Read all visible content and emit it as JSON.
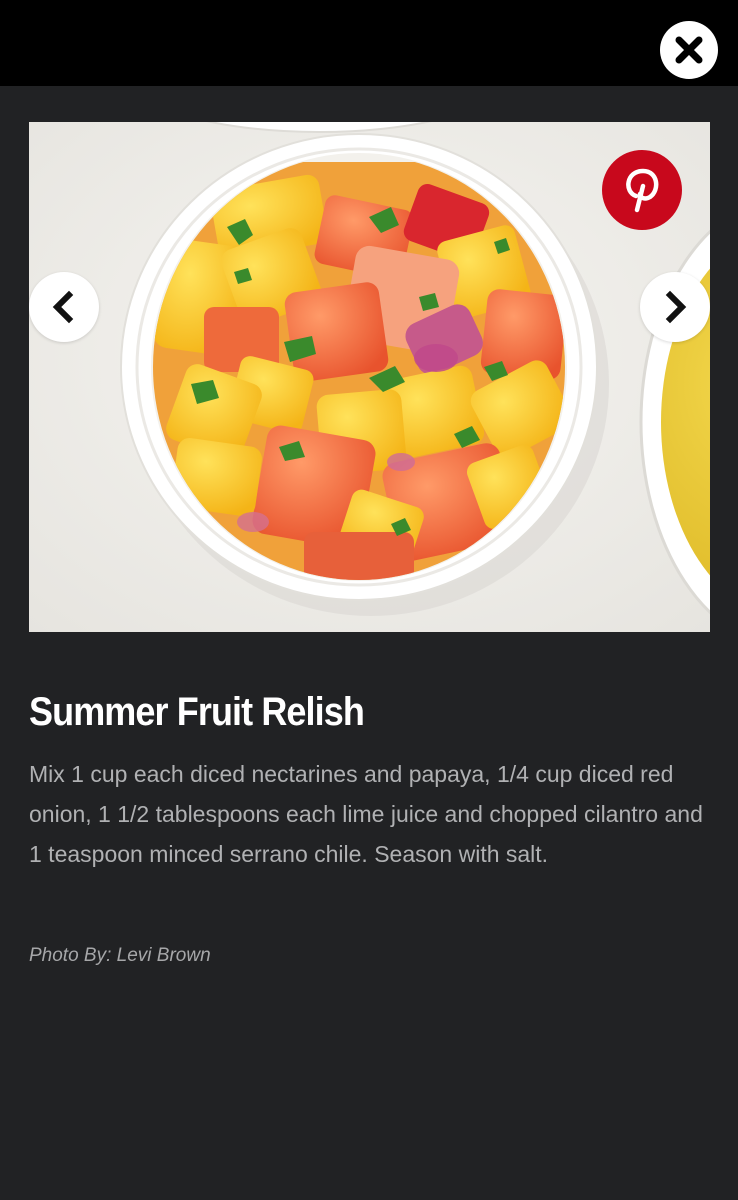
{
  "header": {
    "close_icon": "close-icon"
  },
  "slide": {
    "image_subject": "bowl-of-fruit-relish",
    "pinterest_icon": "pinterest-icon",
    "prev_icon": "chevron-left-icon",
    "next_icon": "chevron-right-icon",
    "title": "Summer Fruit Relish",
    "description": "Mix 1 cup each diced nectarines and papaya, 1/4 cup diced red onion, 1 1/2 tablespoons each lime juice and chopped cilantro and 1 teaspoon minced serrano chile. Season with salt.",
    "credit": "Photo By: Levi Brown"
  },
  "colors": {
    "page_background": "#212224",
    "topbar_background": "#000000",
    "pinterest_red": "#c8081c",
    "title_text": "#ffffff",
    "body_text": "#b0b1b3"
  }
}
